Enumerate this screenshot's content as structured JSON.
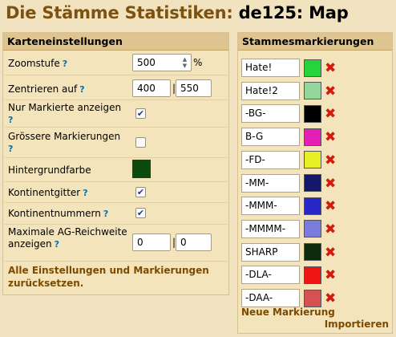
{
  "page": {
    "title_prefix": "Die Stämme Statistiken: ",
    "title_world": "de125",
    "title_suffix": ": Map"
  },
  "map_settings": {
    "header": "Karteneinstellungen",
    "zoom_label": "Zoomstufe",
    "zoom_value": "500",
    "zoom_unit": "%",
    "center_label": "Zentrieren auf",
    "center_x": "400",
    "center_y": "550",
    "only_marked_label": "Nur Markierte anzeigen",
    "only_marked_checked": true,
    "bigger_markers_label": "Grössere Markierungen",
    "bigger_markers_checked": false,
    "background_label": "Hintergrundfarbe",
    "background_color": "#0b4b0f",
    "continent_grid_label": "Kontinentgitter",
    "continent_grid_checked": true,
    "continent_numbers_label": "Kontinentnummern",
    "continent_numbers_checked": true,
    "ag_range_label": "Maximale AG-Reichweite anzeigen",
    "ag_range_x": "0",
    "ag_range_y": "0",
    "help_mark": "?",
    "separator": "|",
    "reset_link": "Alle Einstellungen und Markierungen zurücksetzen."
  },
  "tribe_markers": {
    "header": "Stammesmarkierungen",
    "items": [
      {
        "name": "Hate!",
        "color": "#25d43b"
      },
      {
        "name": "Hate!2",
        "color": "#93d79b"
      },
      {
        "name": "-BG-",
        "color": "#000000"
      },
      {
        "name": "B-G",
        "color": "#e31fb5"
      },
      {
        "name": "-FD-",
        "color": "#e8ef26"
      },
      {
        "name": "-MM-",
        "color": "#16166a"
      },
      {
        "name": "-MMM-",
        "color": "#2727c7"
      },
      {
        "name": "-MMMM-",
        "color": "#7b7bde"
      },
      {
        "name": "SHARP",
        "color": "#0b2b0b"
      },
      {
        "name": "-DLA-",
        "color": "#ee1414"
      },
      {
        "name": "-DAA-",
        "color": "#d65252"
      }
    ],
    "delete_glyph": "✖",
    "new_marker_link": "Neue Markierung",
    "import_link": "Importieren"
  },
  "icons": {
    "checkbox_check": "✔",
    "spinner_up": "▲",
    "spinner_down": "▼"
  }
}
